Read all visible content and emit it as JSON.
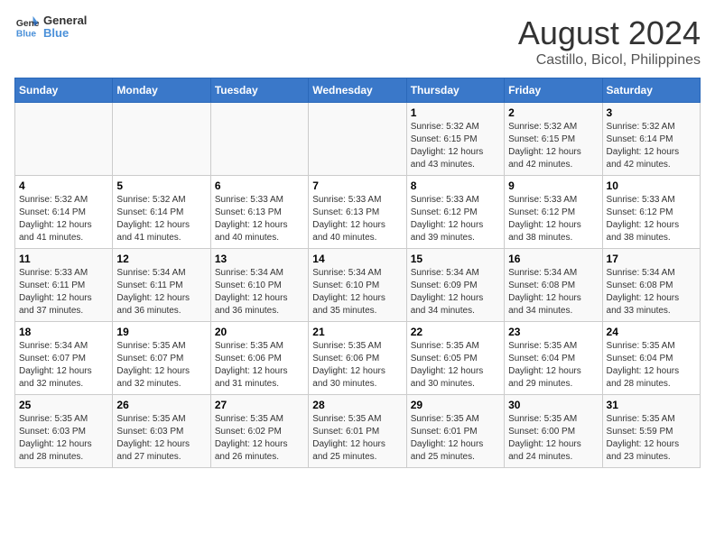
{
  "logo": {
    "line1": "General",
    "line2": "Blue"
  },
  "title": "August 2024",
  "subtitle": "Castillo, Bicol, Philippines",
  "weekdays": [
    "Sunday",
    "Monday",
    "Tuesday",
    "Wednesday",
    "Thursday",
    "Friday",
    "Saturday"
  ],
  "weeks": [
    [
      {
        "day": "",
        "info": ""
      },
      {
        "day": "",
        "info": ""
      },
      {
        "day": "",
        "info": ""
      },
      {
        "day": "",
        "info": ""
      },
      {
        "day": "1",
        "info": "Sunrise: 5:32 AM\nSunset: 6:15 PM\nDaylight: 12 hours\nand 43 minutes."
      },
      {
        "day": "2",
        "info": "Sunrise: 5:32 AM\nSunset: 6:15 PM\nDaylight: 12 hours\nand 42 minutes."
      },
      {
        "day": "3",
        "info": "Sunrise: 5:32 AM\nSunset: 6:14 PM\nDaylight: 12 hours\nand 42 minutes."
      }
    ],
    [
      {
        "day": "4",
        "info": "Sunrise: 5:32 AM\nSunset: 6:14 PM\nDaylight: 12 hours\nand 41 minutes."
      },
      {
        "day": "5",
        "info": "Sunrise: 5:32 AM\nSunset: 6:14 PM\nDaylight: 12 hours\nand 41 minutes."
      },
      {
        "day": "6",
        "info": "Sunrise: 5:33 AM\nSunset: 6:13 PM\nDaylight: 12 hours\nand 40 minutes."
      },
      {
        "day": "7",
        "info": "Sunrise: 5:33 AM\nSunset: 6:13 PM\nDaylight: 12 hours\nand 40 minutes."
      },
      {
        "day": "8",
        "info": "Sunrise: 5:33 AM\nSunset: 6:12 PM\nDaylight: 12 hours\nand 39 minutes."
      },
      {
        "day": "9",
        "info": "Sunrise: 5:33 AM\nSunset: 6:12 PM\nDaylight: 12 hours\nand 38 minutes."
      },
      {
        "day": "10",
        "info": "Sunrise: 5:33 AM\nSunset: 6:12 PM\nDaylight: 12 hours\nand 38 minutes."
      }
    ],
    [
      {
        "day": "11",
        "info": "Sunrise: 5:33 AM\nSunset: 6:11 PM\nDaylight: 12 hours\nand 37 minutes."
      },
      {
        "day": "12",
        "info": "Sunrise: 5:34 AM\nSunset: 6:11 PM\nDaylight: 12 hours\nand 36 minutes."
      },
      {
        "day": "13",
        "info": "Sunrise: 5:34 AM\nSunset: 6:10 PM\nDaylight: 12 hours\nand 36 minutes."
      },
      {
        "day": "14",
        "info": "Sunrise: 5:34 AM\nSunset: 6:10 PM\nDaylight: 12 hours\nand 35 minutes."
      },
      {
        "day": "15",
        "info": "Sunrise: 5:34 AM\nSunset: 6:09 PM\nDaylight: 12 hours\nand 34 minutes."
      },
      {
        "day": "16",
        "info": "Sunrise: 5:34 AM\nSunset: 6:08 PM\nDaylight: 12 hours\nand 34 minutes."
      },
      {
        "day": "17",
        "info": "Sunrise: 5:34 AM\nSunset: 6:08 PM\nDaylight: 12 hours\nand 33 minutes."
      }
    ],
    [
      {
        "day": "18",
        "info": "Sunrise: 5:34 AM\nSunset: 6:07 PM\nDaylight: 12 hours\nand 32 minutes."
      },
      {
        "day": "19",
        "info": "Sunrise: 5:35 AM\nSunset: 6:07 PM\nDaylight: 12 hours\nand 32 minutes."
      },
      {
        "day": "20",
        "info": "Sunrise: 5:35 AM\nSunset: 6:06 PM\nDaylight: 12 hours\nand 31 minutes."
      },
      {
        "day": "21",
        "info": "Sunrise: 5:35 AM\nSunset: 6:06 PM\nDaylight: 12 hours\nand 30 minutes."
      },
      {
        "day": "22",
        "info": "Sunrise: 5:35 AM\nSunset: 6:05 PM\nDaylight: 12 hours\nand 30 minutes."
      },
      {
        "day": "23",
        "info": "Sunrise: 5:35 AM\nSunset: 6:04 PM\nDaylight: 12 hours\nand 29 minutes."
      },
      {
        "day": "24",
        "info": "Sunrise: 5:35 AM\nSunset: 6:04 PM\nDaylight: 12 hours\nand 28 minutes."
      }
    ],
    [
      {
        "day": "25",
        "info": "Sunrise: 5:35 AM\nSunset: 6:03 PM\nDaylight: 12 hours\nand 28 minutes."
      },
      {
        "day": "26",
        "info": "Sunrise: 5:35 AM\nSunset: 6:03 PM\nDaylight: 12 hours\nand 27 minutes."
      },
      {
        "day": "27",
        "info": "Sunrise: 5:35 AM\nSunset: 6:02 PM\nDaylight: 12 hours\nand 26 minutes."
      },
      {
        "day": "28",
        "info": "Sunrise: 5:35 AM\nSunset: 6:01 PM\nDaylight: 12 hours\nand 25 minutes."
      },
      {
        "day": "29",
        "info": "Sunrise: 5:35 AM\nSunset: 6:01 PM\nDaylight: 12 hours\nand 25 minutes."
      },
      {
        "day": "30",
        "info": "Sunrise: 5:35 AM\nSunset: 6:00 PM\nDaylight: 12 hours\nand 24 minutes."
      },
      {
        "day": "31",
        "info": "Sunrise: 5:35 AM\nSunset: 5:59 PM\nDaylight: 12 hours\nand 23 minutes."
      }
    ]
  ]
}
